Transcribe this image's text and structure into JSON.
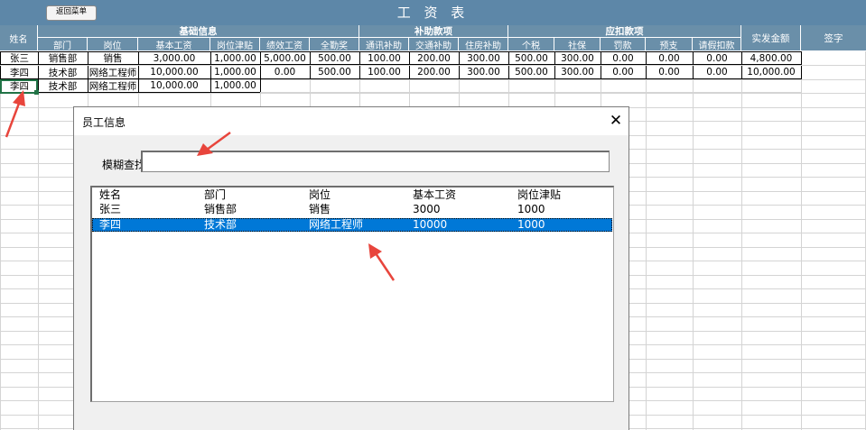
{
  "sheet": {
    "title": "工 资 表",
    "back_button": "返回菜单",
    "name_header": "姓名",
    "groups": {
      "basic": "基础信息",
      "allowance": "补助款项",
      "deduct": "应扣款项",
      "net": "实发金额",
      "sign": "签字"
    },
    "columns": [
      "部门",
      "岗位",
      "基本工资",
      "岗位津贴",
      "绩效工资",
      "全勤奖",
      "通讯补助",
      "交通补助",
      "住房补助",
      "个税",
      "社保",
      "罚款",
      "预支",
      "请假扣款"
    ],
    "rows": [
      {
        "name": "张三",
        "cells": [
          "销售部",
          "销售",
          "3,000.00",
          "1,000.00",
          "5,000.00",
          "500.00",
          "100.00",
          "200.00",
          "300.00",
          "500.00",
          "300.00",
          "0.00",
          "0.00",
          "0.00"
        ],
        "net": "4,800.00"
      },
      {
        "name": "李四",
        "cells": [
          "技术部",
          "网络工程师",
          "10,000.00",
          "1,000.00",
          "0.00",
          "500.00",
          "100.00",
          "200.00",
          "300.00",
          "500.00",
          "300.00",
          "0.00",
          "0.00",
          "0.00"
        ],
        "net": "10,000.00"
      },
      {
        "name": "李四",
        "cells": [
          "技术部",
          "网络工程师",
          "10,000.00",
          "1,000.00",
          "",
          "",
          "",
          "",
          "",
          "",
          "",
          "",
          "",
          ""
        ],
        "net": ""
      }
    ]
  },
  "dialog": {
    "title": "员工信息",
    "close_glyph": "✕",
    "search_label": "模糊查找:",
    "search_value": "",
    "list_headers": [
      "姓名",
      "部门",
      "岗位",
      "基本工资",
      "岗位津贴"
    ],
    "list_rows": [
      [
        "张三",
        "销售部",
        "销售",
        "3000",
        "1000"
      ],
      [
        "李四",
        "技术部",
        "网络工程师",
        "10000",
        "1000"
      ]
    ],
    "selected_index": 1
  },
  "colors": {
    "header_bg": "#6a8fa9",
    "title_bg": "#5d87a8",
    "selection": "#0078d7",
    "annotation_arrow": "#e8453c",
    "active_cell": "#217346"
  }
}
